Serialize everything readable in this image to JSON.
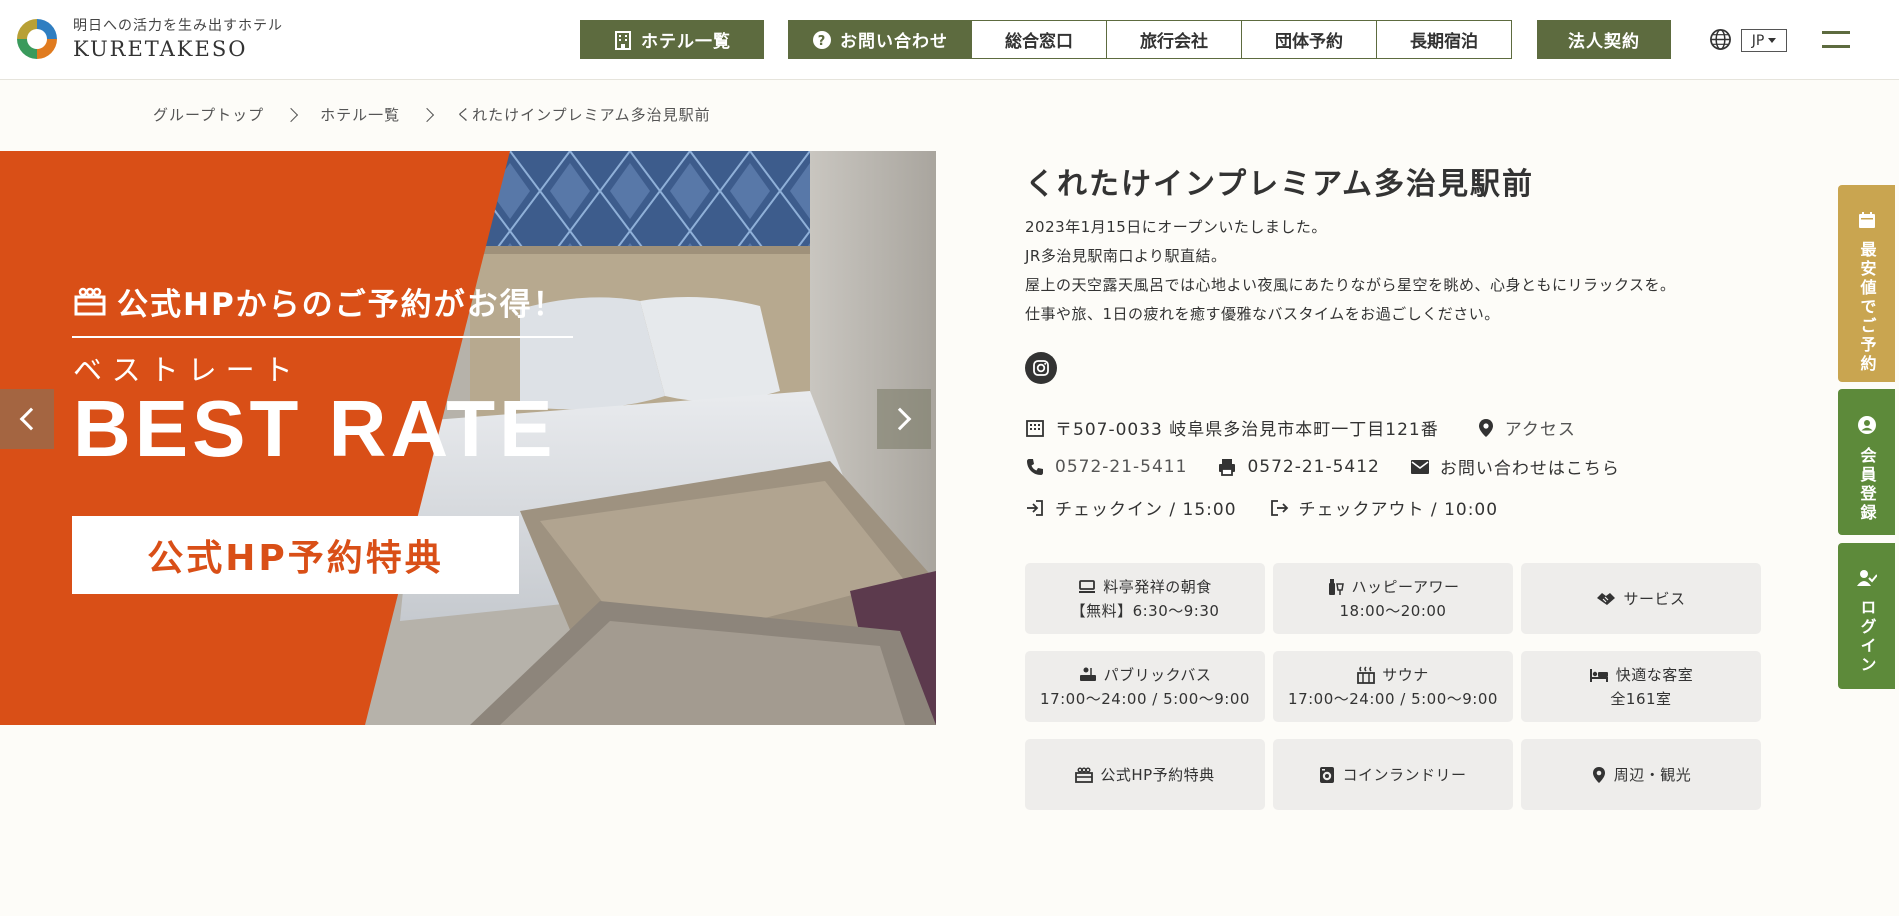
{
  "header": {
    "tagline": "明日への活力を生み出すホテル",
    "brand": "KURETAKESO",
    "hotels_label": "ホテル一覧",
    "contact_label": "お問い合わせ",
    "contact_items": [
      "総合窓口",
      "旅行会社",
      "団体予約",
      "長期宿泊"
    ],
    "corporate_label": "法人契約",
    "lang_label": "JP"
  },
  "breadcrumb": [
    "グループトップ",
    "ホテル一覧",
    "くれたけインプレミアム多治見駅前"
  ],
  "hero": {
    "promo_top": "公式HPからのご予約がお得！",
    "best_kana": "ベストレート",
    "best_rate": "BEST RATE",
    "promo_box": "公式HP予約特典"
  },
  "hotel": {
    "title": "くれたけインプレミアム多治見駅前",
    "description": [
      "2023年1月15日にオープンいたしました。",
      "JR多治見駅南口より駅直結。",
      "屋上の天空露天風呂では心地よい夜風にあたりながら星空を眺め、心身ともにリラックスを。",
      "仕事や旅、1日の疲れを癒す優雅なバスタイムをお過ごしください。"
    ],
    "address": "〒507-0033 岐阜県多治見市本町一丁目121番",
    "access_label": "アクセス",
    "tel": "0572-21-5411",
    "fax": "0572-21-5412",
    "inquiry_label": "お問い合わせはこちら",
    "checkin": "チェックイン / 15:00",
    "checkout": "チェックアウト / 10:00"
  },
  "features": [
    {
      "icon": "breakfast-icon",
      "title": "料亭発祥の朝食",
      "sub": "【無料】6:30〜9:30"
    },
    {
      "icon": "happy-hour-icon",
      "title": "ハッピーアワー",
      "sub": "18:00〜20:00"
    },
    {
      "icon": "service-icon",
      "title": "サービス",
      "sub": ""
    },
    {
      "icon": "bath-icon",
      "title": "パブリックバス",
      "sub": "17:00〜24:00 / 5:00〜9:00"
    },
    {
      "icon": "sauna-icon",
      "title": "サウナ",
      "sub": "17:00〜24:00 / 5:00〜9:00"
    },
    {
      "icon": "bed-icon",
      "title": "快適な客室",
      "sub": "全161室"
    },
    {
      "icon": "gift-icon",
      "title": "公式HP予約特典",
      "sub": ""
    },
    {
      "icon": "laundry-icon",
      "title": "コインランドリー",
      "sub": ""
    },
    {
      "icon": "pin-icon",
      "title": "周辺・観光",
      "sub": ""
    }
  ],
  "side_tabs": {
    "best_price": "最安値でご予約",
    "member": "会員登録",
    "login": "ログイン"
  },
  "colors": {
    "accent_green": "#5d6b3f",
    "promo_orange": "#d94f17",
    "gold": "#c9a550",
    "side_green": "#5d8a3a"
  }
}
